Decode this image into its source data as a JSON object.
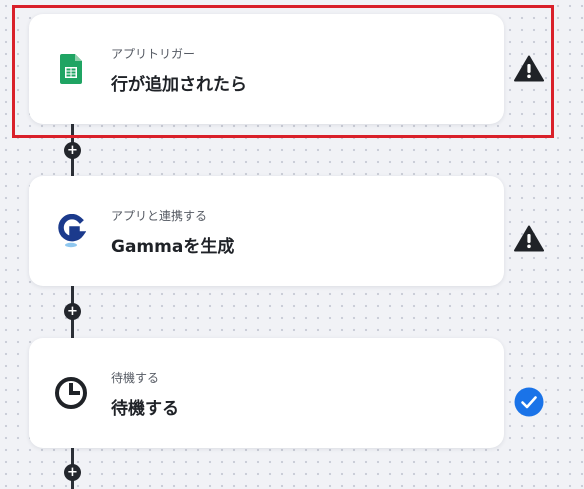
{
  "steps": [
    {
      "subtitle": "アプリトリガー",
      "title": "行が追加されたら",
      "icon": "google-sheets-icon",
      "status": "warning",
      "selected": true
    },
    {
      "subtitle": "アプリと連携する",
      "title": "Gammaを生成",
      "icon": "gamma-icon",
      "status": "warning",
      "selected": false
    },
    {
      "subtitle": "待機する",
      "title": "待機する",
      "icon": "clock-icon",
      "status": "completed",
      "selected": false
    }
  ],
  "add_button_glyph": "+",
  "colors": {
    "canvas_background": "#f1f2f6",
    "card_background": "#ffffff",
    "selection_border": "#d9202a",
    "warning": "#1f2227",
    "completed": "#1a73e8",
    "sheets_green": "#1fa463",
    "gamma_blue": "#1b3a8c",
    "connector": "#2b2f36"
  }
}
